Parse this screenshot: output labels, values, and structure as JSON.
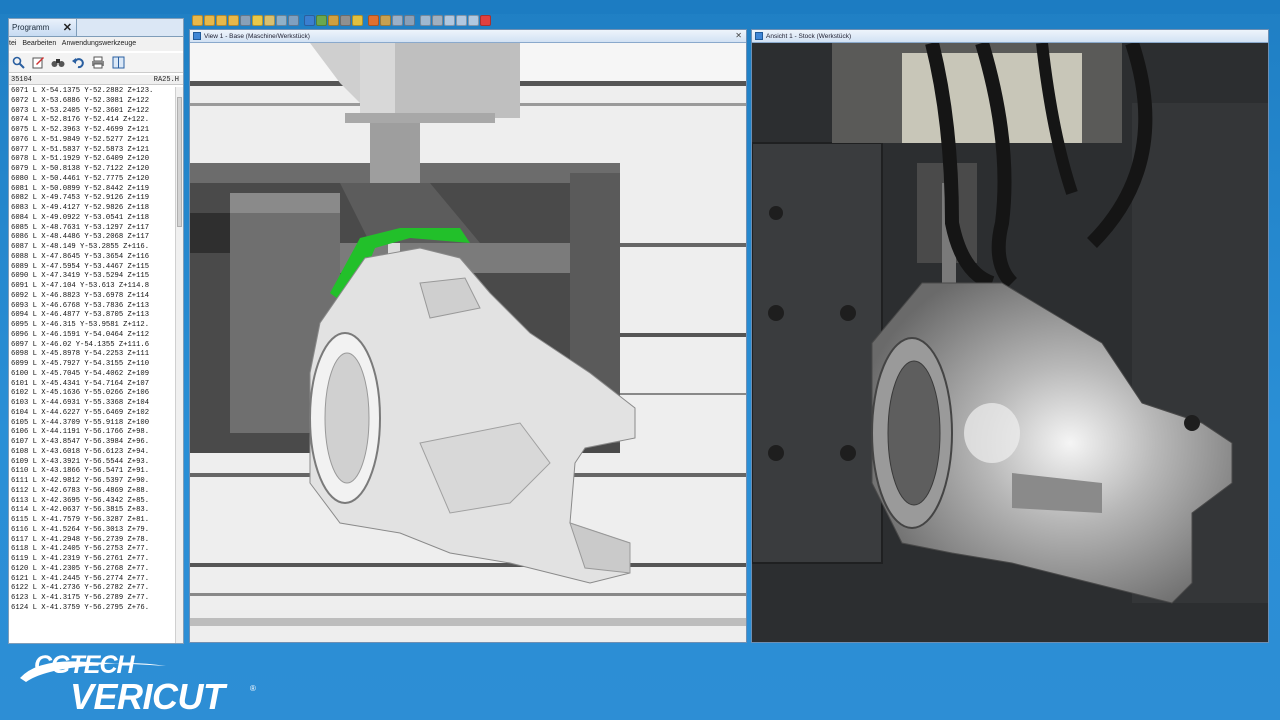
{
  "program_panel": {
    "tab_label": "Programm",
    "close_glyph": "✕",
    "menu": [
      "tei",
      "Bearbeiten",
      "Anwendungswerkzeuge"
    ],
    "toolbar_icons": [
      "search-icon",
      "edit-icon",
      "find-icon",
      "undo-icon",
      "print-icon",
      "split-icon"
    ],
    "header_line": "35104",
    "header_right": "RA25.H",
    "lines": [
      "6071 L  X-54.1375  Y-52.2882  Z+123.",
      "6072 L  X-53.6886  Y-52.3081  Z+122",
      "6073 L  X-53.2405  Y-52.3601  Z+122",
      "6074 L  X-52.8176  Y-52.414   Z+122.",
      "6075 L  X-52.3963  Y-52.4699  Z+121",
      "6076 L  X-51.9849  Y-52.5277  Z+121",
      "6077 L  X-51.5837  Y-52.5873  Z+121",
      "6078 L  X-51.1929  Y-52.6409  Z+120",
      "6079 L  X-50.8138  Y-52.7122  Z+120",
      "6080 L  X-50.4461  Y-52.7775  Z+120",
      "6081 L  X-50.0899  Y-52.8442  Z+119",
      "6082 L  X-49.7453  Y-52.9126  Z+119",
      "6083 L  X-49.4127  Y-52.9826  Z+118",
      "6084 L  X-49.0922  Y-53.0541  Z+118",
      "6085 L  X-48.7631  Y-53.1297  Z+117",
      "6086 L  X-48.4486  Y-53.2068  Z+117",
      "6087 L  X-48.149   Y-53.2855  Z+116.",
      "6088 L  X-47.8645  Y-53.3654  Z+116",
      "6089 L  X-47.5954  Y-53.4467  Z+115",
      "6090 L  X-47.3419  Y-53.5294  Z+115",
      "6091 L  X-47.104   Y-53.613   Z+114.8",
      "6092 L  X-46.8823  Y-53.6978  Z+114",
      "6093 L  X-46.6768  Y-53.7836  Z+113",
      "6094 L  X-46.4877  Y-53.8705  Z+113",
      "6095 L  X-46.315   Y-53.9581  Z+112.",
      "6096 L  X-46.1591  Y-54.0464  Z+112",
      "6097 L  X-46.02    Y-54.1355  Z+111.6",
      "6098 L  X-45.8978  Y-54.2253  Z+111",
      "6099 L  X-45.7927  Y-54.3155  Z+110",
      "6100 L  X-45.7045  Y-54.4062  Z+109",
      "6101 L  X-45.4341  Y-54.7164  Z+107",
      "6102 L  X-45.1636  Y-55.0266  Z+106",
      "6103 L  X-44.6931  Y-55.3368  Z+104",
      "6104 L  X-44.6227  Y-55.6469  Z+102",
      "6105 L  X-44.3709  Y-55.9118  Z+100",
      "6106 L  X-44.1191  Y-56.1766  Z+98.",
      "6107 L  X-43.8547  Y-56.3984  Z+96.",
      "6108 L  X-43.6018  Y-56.6123  Z+94.",
      "6109 L  X-43.3921  Y-56.5544  Z+93.",
      "6110 L  X-43.1866  Y-56.5471  Z+91.",
      "6111 L  X-42.9812  Y-56.5397  Z+90.",
      "6112 L  X-42.6783  Y-56.4869  Z+88.",
      "6113 L  X-42.3695  Y-56.4342  Z+85.",
      "6114 L  X-42.0637  Y-56.3815  Z+83.",
      "6115 L  X-41.7579  Y-56.3287  Z+81.",
      "6116 L  X-41.5264  Y-56.3013  Z+79.",
      "6117 L  X-41.2948  Y-56.2739  Z+78.",
      "6118 L  X-41.2405  Y-56.2753  Z+77.",
      "6119 L  X-41.2319  Y-56.2761  Z+77.",
      "6120 L  X-41.2305  Y-56.2768  Z+77.",
      "6121 L  X-41.2445  Y-56.2774  Z+77.",
      "6122 L  X-41.2736  Y-56.2782  Z+77.",
      "6123 L  X-41.3175  Y-56.2789  Z+77.",
      "6124 L  X-41.3759  Y-56.2795  Z+76."
    ]
  },
  "main_toolbar": {
    "icons": [
      {
        "name": "open-icon",
        "color": "#e8b84a"
      },
      {
        "name": "save-icon",
        "color": "#e8b84a"
      },
      {
        "name": "save-as-icon",
        "color": "#e8b84a"
      },
      {
        "name": "project-icon",
        "color": "#e8b84a"
      },
      {
        "name": "setup-icon",
        "color": "#8aa0b8"
      },
      {
        "name": "tool-icon",
        "color": "#e8c84a"
      },
      {
        "name": "machine-icon",
        "color": "#d8c070"
      },
      {
        "name": "control-icon",
        "color": "#8fb0c8"
      },
      {
        "name": "nc-program-icon",
        "color": "#7fa0c0"
      },
      {
        "name": "info-icon",
        "color": "#3b7fd0"
      },
      {
        "name": "model-icon",
        "color": "#6aa84f"
      },
      {
        "name": "colors-icon",
        "color": "#d0a040"
      },
      {
        "name": "settings-icon",
        "color": "#909090"
      },
      {
        "name": "preferences-icon",
        "color": "#e0c040"
      },
      {
        "name": "stop-icon",
        "color": "#e07030"
      },
      {
        "name": "measure-icon",
        "color": "#c8a050"
      },
      {
        "name": "zoom-icon",
        "color": "#9ab0c8"
      },
      {
        "name": "section-icon",
        "color": "#8aa0b8"
      },
      {
        "name": "compare-icon",
        "color": "#a0b8d0"
      },
      {
        "name": "report-icon",
        "color": "#a0b0c0"
      },
      {
        "name": "layout-icon",
        "color": "#b0c8e0"
      },
      {
        "name": "window-icon",
        "color": "#b0c8e0"
      },
      {
        "name": "tile-icon",
        "color": "#b0c8e0"
      },
      {
        "name": "exit-icon",
        "color": "#e04040"
      }
    ]
  },
  "view1": {
    "title": "View 1 - Base (Maschine/Werkstück)",
    "close_glyph": "✕"
  },
  "view2": {
    "title": "Ansicht 1 - Stock (Werkstück)"
  },
  "logo": {
    "brand": "CGTECH",
    "product": "VERICUT",
    "registered": "®"
  },
  "colors": {
    "background": "#2a8fd6",
    "highlight_cut": "#22c02a",
    "panel_border": "#7f9db9"
  }
}
